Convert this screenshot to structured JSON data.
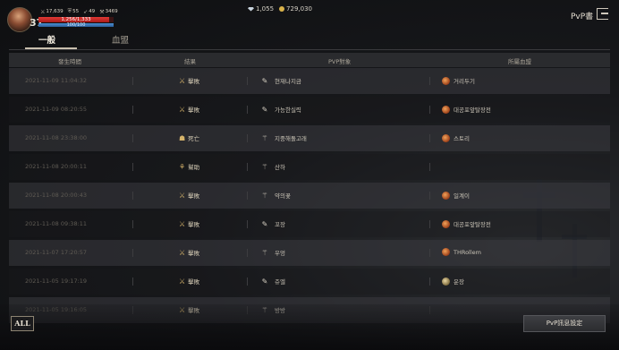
{
  "player": {
    "level": "37",
    "stats": [
      {
        "icon": "attack-icon",
        "glyph": "⚔",
        "value": "17,639"
      },
      {
        "icon": "defense-icon",
        "glyph": "⛨",
        "value": "55"
      },
      {
        "icon": "hit-icon",
        "glyph": "➶",
        "value": "49"
      },
      {
        "icon": "power-icon",
        "glyph": "⚒",
        "value": "3469"
      }
    ],
    "hp_text": "1,256/1,333",
    "hp_fraction": 0.94,
    "mp_text": "100/100",
    "mp_fraction": 1.0
  },
  "currency": {
    "diamonds": "1,055",
    "gold": "729,030"
  },
  "header": {
    "pvp_book": "PvP書"
  },
  "tabs": {
    "general": "一般",
    "blood_alliance": "血盟"
  },
  "table": {
    "headers": {
      "time": "發生時間",
      "result": "結果",
      "target": "PVP對象",
      "guild": "所屬血盟"
    },
    "rows": [
      {
        "time": "2021-11-09 11:04:32",
        "result": "擊敗",
        "result_icon": "swords-icon",
        "target": "현재나지금",
        "target_icon": "dagger-icon",
        "guild": "거리두기",
        "guild_icon": "guild-emblem-icon"
      },
      {
        "time": "2021-11-09 08:20:55",
        "result": "擊敗",
        "result_icon": "swords-icon",
        "target": "가능한실력",
        "target_icon": "dagger-icon",
        "guild": "대공포앞탈장전",
        "guild_icon": "guild-emblem-icon"
      },
      {
        "time": "2021-11-08 23:38:00",
        "result": "死亡",
        "result_icon": "skull-icon",
        "target": "지중해돌고래",
        "target_icon": "bow-icon",
        "guild": "스토리",
        "guild_icon": "guild-emblem-icon"
      },
      {
        "time": "2021-11-08 20:00:11",
        "result": "幫助",
        "result_icon": "handshake-icon",
        "target": "산하",
        "target_icon": "bow-icon",
        "guild": "",
        "guild_icon": ""
      },
      {
        "time": "2021-11-08 20:00:43",
        "result": "擊敗",
        "result_icon": "swords-icon",
        "target": "약의꽃",
        "target_icon": "bow-icon",
        "guild": "일계이",
        "guild_icon": "guild-emblem-icon"
      },
      {
        "time": "2021-11-08 09:38:11",
        "result": "擊敗",
        "result_icon": "swords-icon",
        "target": "꼬장",
        "target_icon": "dagger-icon",
        "guild": "대공포앞탈장전",
        "guild_icon": "guild-emblem-icon"
      },
      {
        "time": "2021-11-07 17:20:57",
        "result": "擊敗",
        "result_icon": "swords-icon",
        "target": "우엉",
        "target_icon": "bow-icon",
        "guild": "THRollem",
        "guild_icon": "guild-emblem-icon"
      },
      {
        "time": "2021-11-05 19:17:19",
        "result": "擊敗",
        "result_icon": "swords-icon",
        "target": "쥬엘",
        "target_icon": "dagger-icon",
        "guild": "운장",
        "guild_icon": "moon-emblem-icon"
      },
      {
        "time": "2021-11-05 19:16:05",
        "result": "擊敗",
        "result_icon": "swords-icon",
        "target": "방방",
        "target_icon": "bow-icon",
        "guild": "",
        "guild_icon": ""
      }
    ]
  },
  "footer": {
    "all_label": "ALL",
    "settings_label": "PvP訊息設定"
  }
}
